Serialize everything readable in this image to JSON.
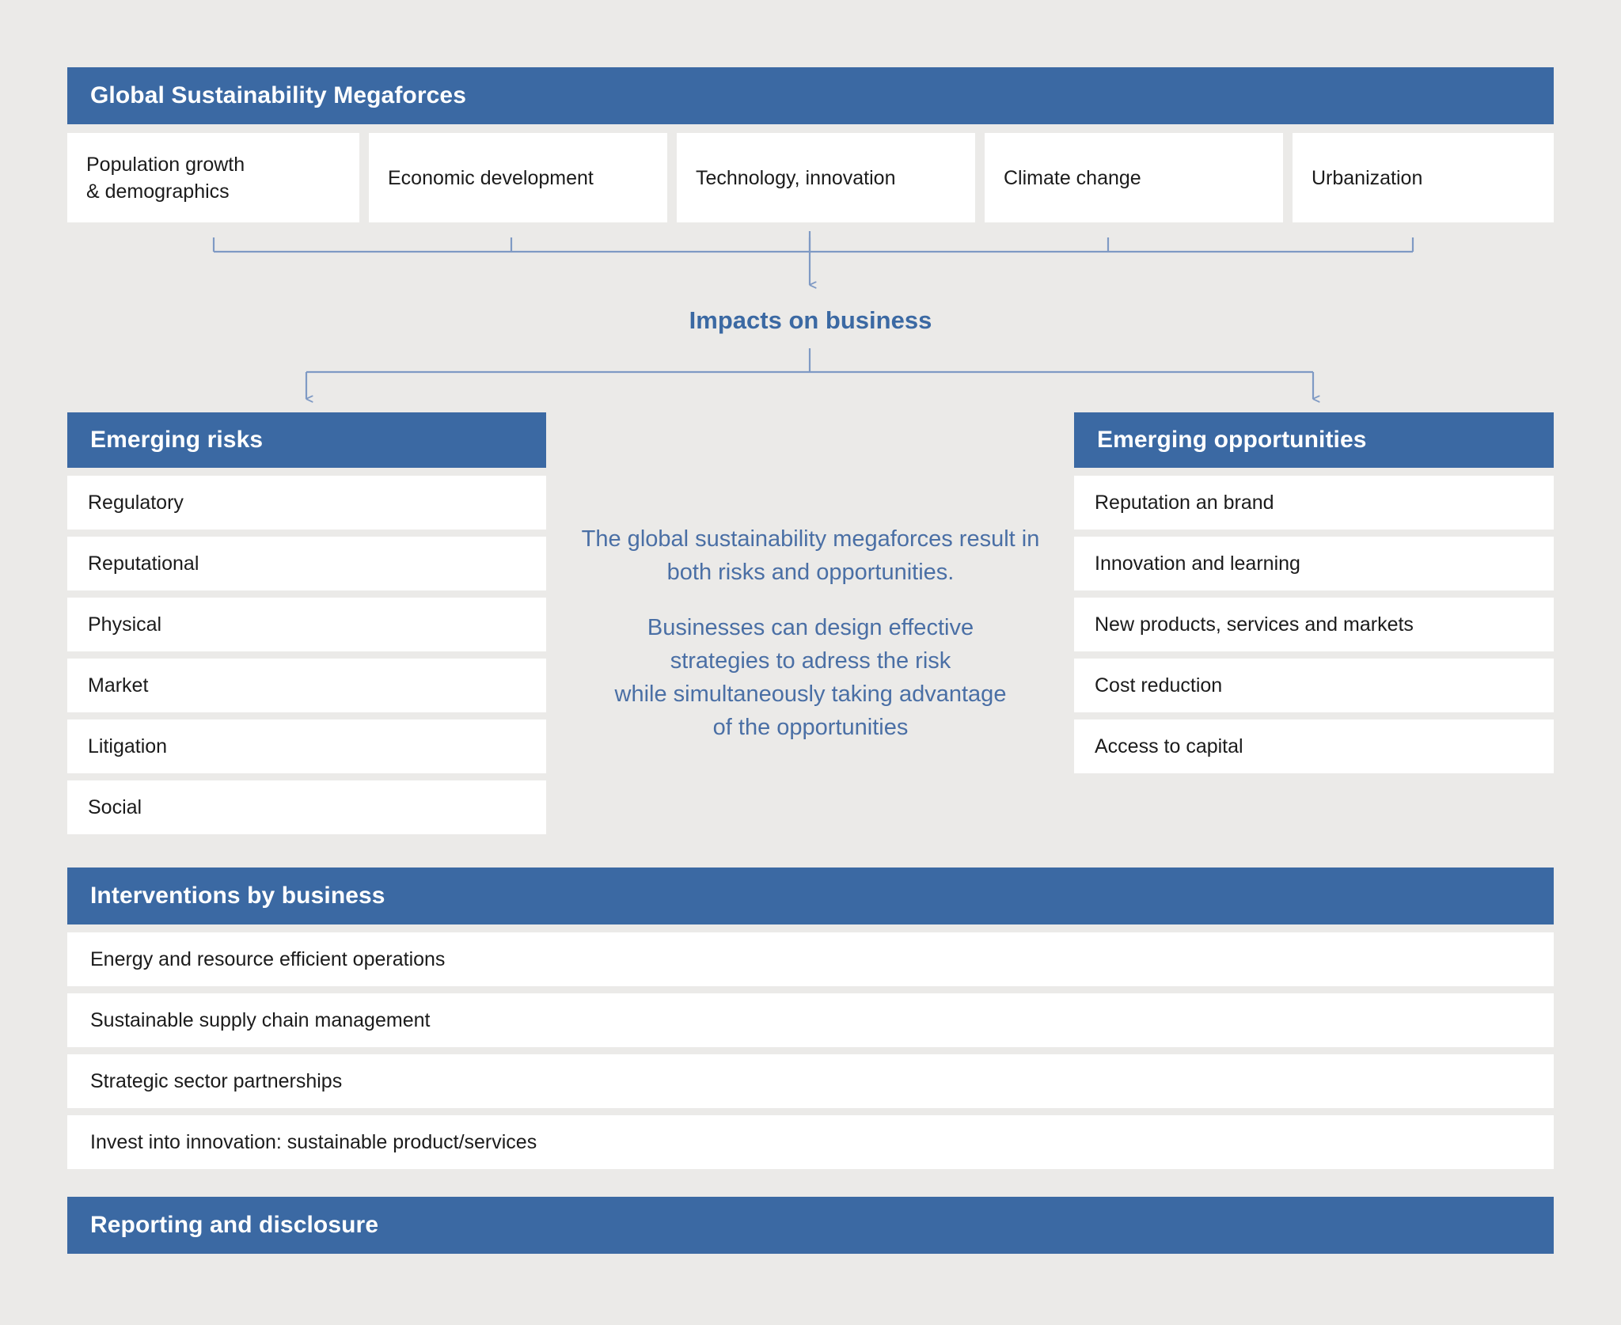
{
  "colors": {
    "background": "#ebeae8",
    "brand_blue": "#3b69a3",
    "card_white": "#ffffff",
    "connector_blue": "#7f9ac4",
    "note_text": "#4a6fa5",
    "body_text": "#1b1b1b"
  },
  "megaforces": {
    "title": "Global Sustainability Megaforces",
    "cells": [
      {
        "line1": "Population growth",
        "line2": "& demographics"
      },
      {
        "line1": "Economic development",
        "line2": ""
      },
      {
        "line1": "Technology, innovation",
        "line2": ""
      },
      {
        "line1": "Climate change",
        "line2": ""
      },
      {
        "line1": "Urbanization",
        "line2": ""
      }
    ]
  },
  "impacts": {
    "label": "Impacts on business"
  },
  "risks": {
    "title": "Emerging risks",
    "items": [
      "Regulatory",
      "Reputational",
      "Physical",
      "Market",
      "Litigation",
      "Social"
    ]
  },
  "opportunities": {
    "title": "Emerging opportunities",
    "items": [
      "Reputation an brand",
      "Innovation and learning",
      "New products, services and markets",
      "Cost reduction",
      "Access to capital"
    ]
  },
  "center_note": {
    "paragraph1": "The global sustainability megaforces result in both risks and opportunities.",
    "paragraph2_line1": "Businesses can design effective",
    "paragraph2_line2": "strategies to adress the risk",
    "paragraph2_line3": "while simultaneously taking advantage",
    "paragraph2_line4": "of the opportunities"
  },
  "interventions": {
    "title": "Interventions by business",
    "items": [
      "Energy and resource efficient operations",
      "Sustainable supply chain management",
      "Strategic sector partnerships",
      "Invest into innovation: sustainable product/services"
    ]
  },
  "reporting": {
    "title": "Reporting and disclosure"
  }
}
